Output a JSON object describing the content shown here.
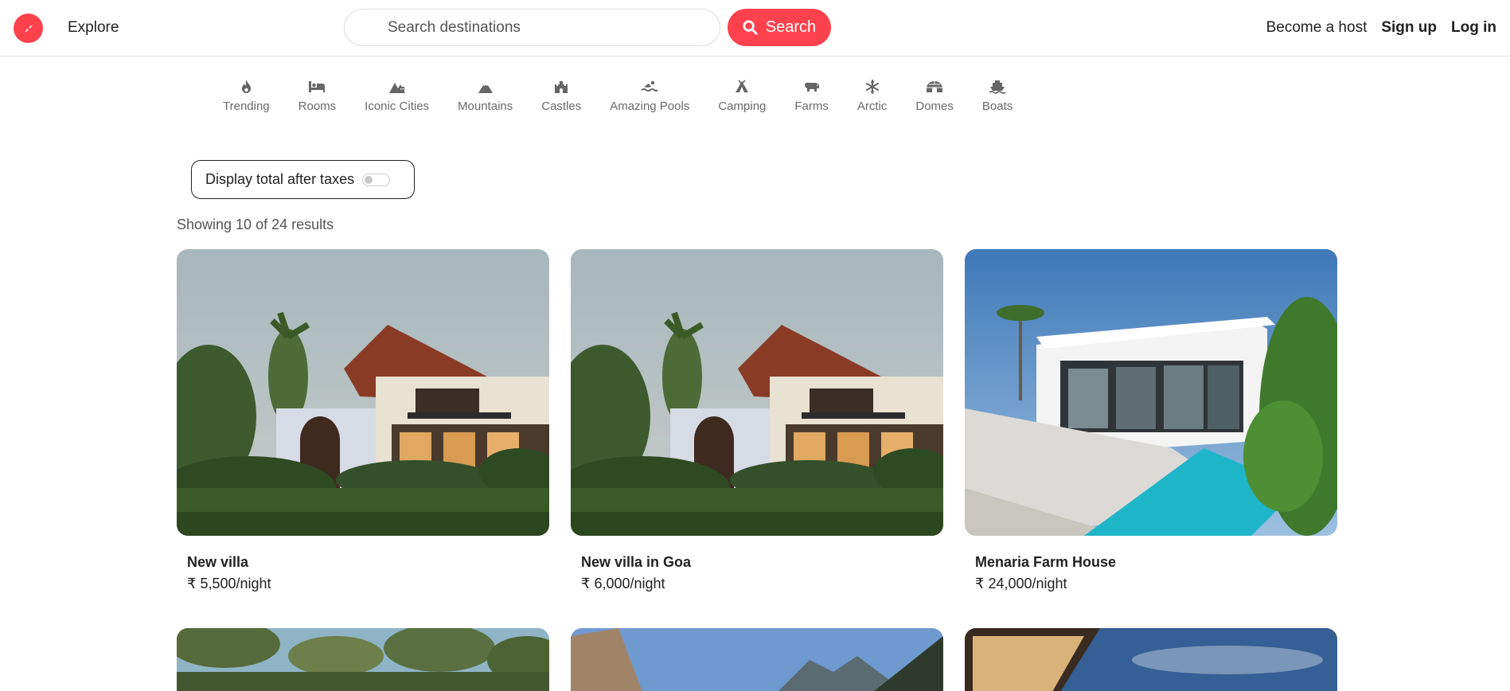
{
  "nav": {
    "logo_icon": "compass-icon",
    "explore_label": "Explore",
    "search_placeholder": "Search destinations",
    "search_button_label": "Search",
    "become_host_label": "Become a host",
    "signup_label": "Sign up",
    "login_label": "Log in"
  },
  "filters": [
    {
      "label": "Trending",
      "icon": "fire-icon"
    },
    {
      "label": "Rooms",
      "icon": "bed-icon"
    },
    {
      "label": "Iconic Cities",
      "icon": "mountain-city-icon"
    },
    {
      "label": "Mountains",
      "icon": "mountain-icon"
    },
    {
      "label": "Castles",
      "icon": "castle-icon"
    },
    {
      "label": "Amazing Pools",
      "icon": "person-swimming-icon"
    },
    {
      "label": "Camping",
      "icon": "campground-icon"
    },
    {
      "label": "Farms",
      "icon": "cow-icon"
    },
    {
      "label": "Arctic",
      "icon": "snowflake-icon"
    },
    {
      "label": "Domes",
      "icon": "igloo-icon"
    },
    {
      "label": "Boats",
      "icon": "ship-icon"
    }
  ],
  "tax_toggle": {
    "label": "Display total after taxes",
    "checked": false
  },
  "results_text": "Showing 10 of 24 results",
  "listings": [
    {
      "title": "New villa",
      "price": "₹ 5,500/night"
    },
    {
      "title": "New villa in Goa",
      "price": "₹ 6,000/night"
    },
    {
      "title": "Menaria Farm House",
      "price": "₹ 24,000/night"
    },
    {
      "title": "",
      "price": ""
    },
    {
      "title": "",
      "price": ""
    },
    {
      "title": "",
      "price": ""
    }
  ],
  "colors": {
    "accent": "#fe424d"
  }
}
